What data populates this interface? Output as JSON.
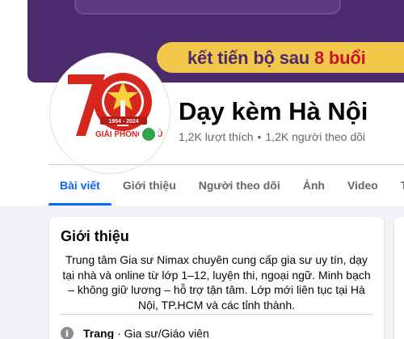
{
  "cover": {
    "slogan_start": "kết tiến bộ sau ",
    "slogan_highlight": "8 buổi"
  },
  "avatar": {
    "number": "70",
    "years": "1954 - 2024",
    "caption": "GIẢI PHÓNG THỦ Đ"
  },
  "profile": {
    "name": "Dạy kèm Hà Nội",
    "likes": "1,2K lượt thích",
    "separator": "•",
    "followers": "1,2K người theo dõi"
  },
  "tabs": [
    "Bài viết",
    "Giới thiệu",
    "Người theo dõi",
    "Ảnh",
    "Video",
    "Trực tiế"
  ],
  "intro": {
    "title": "Giới thiệu",
    "description": "Trung tâm Gia sư Nimax chuyên cung cấp gia sư uy tín, dạy tại nhà và online từ lớp 1–12, luyện thi, ngoại ngữ. Minh bạch – không giữ lương – hỗ trợ tận tâm. Lớp mới liên tục tại Hà Nội, TP.HCM và các tỉnh thành.",
    "category_label": "Trang",
    "category_value": "· Gia sư/Giáo viên"
  },
  "colors": {
    "accent": "#0866ff",
    "cover": "#4b2a6e",
    "cover_bar": "#f2c84a",
    "online": "#31a24c",
    "logo_red": "#d7261e"
  }
}
